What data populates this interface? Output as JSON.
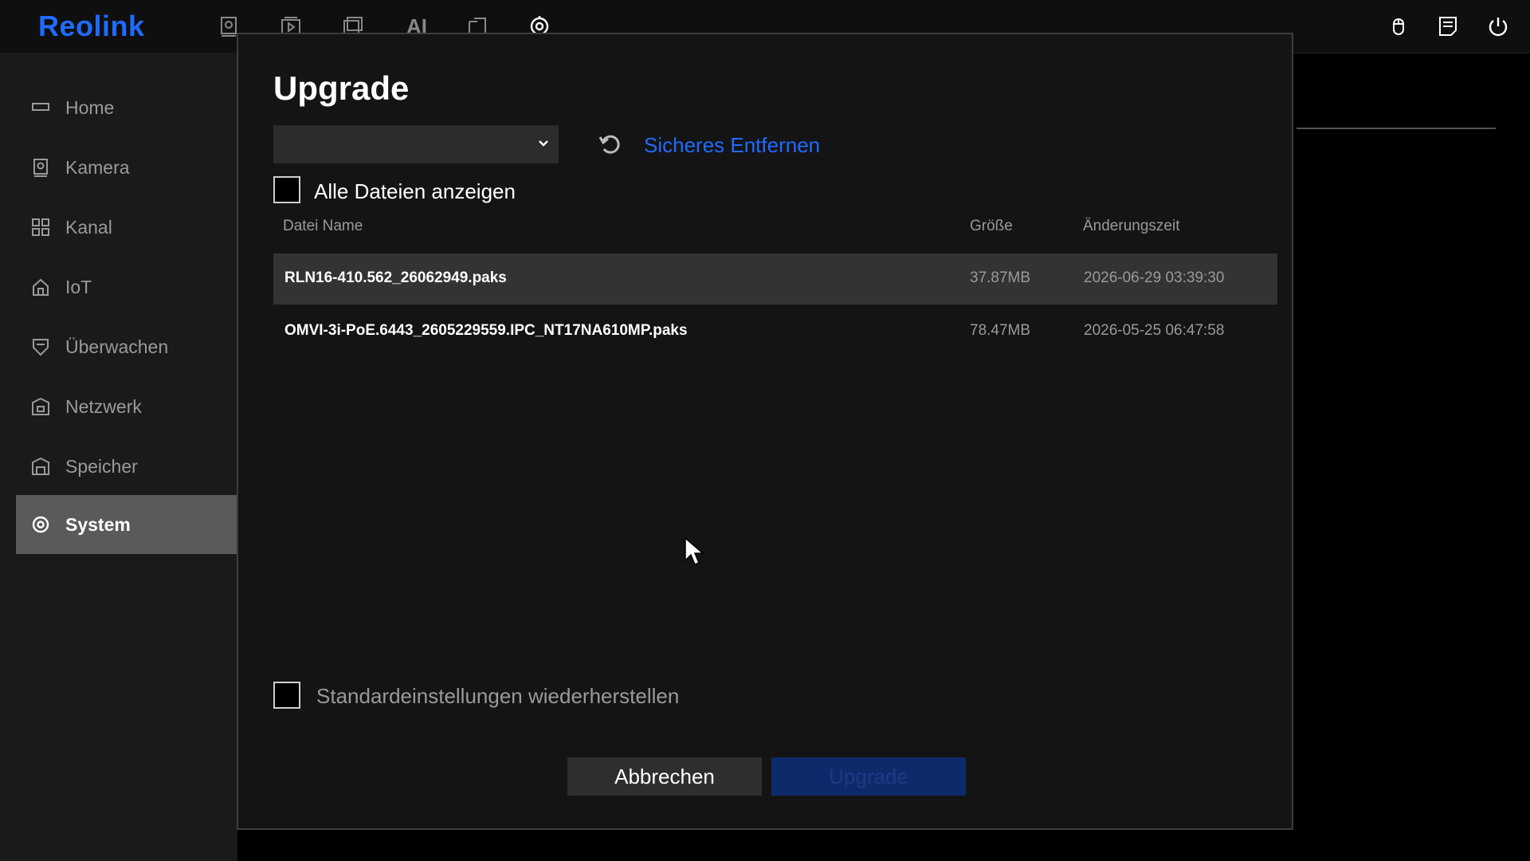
{
  "app": {
    "logo_text": "Reolink",
    "brand_color": "#1f6bff"
  },
  "topbar": {
    "icons": [
      "live-view-icon",
      "playback-icon",
      "backup-icon",
      "ai-icon",
      "file-icon",
      "settings-icon"
    ],
    "ai_label": "AI",
    "right_icons": [
      "mouse-icon",
      "notes-icon",
      "power-icon"
    ]
  },
  "sidebar": {
    "items": [
      {
        "label": "Home",
        "icon": "home-icon"
      },
      {
        "label": "Kamera",
        "icon": "camera-icon"
      },
      {
        "label": "Kanal",
        "icon": "grid-icon"
      },
      {
        "label": "IoT",
        "icon": "iot-icon"
      },
      {
        "label": "Überwachen",
        "icon": "shield-icon"
      },
      {
        "label": "Netzwerk",
        "icon": "network-icon"
      },
      {
        "label": "Speicher",
        "icon": "storage-icon"
      },
      {
        "label": "System",
        "icon": "gear-icon",
        "active": true
      }
    ]
  },
  "modal": {
    "title": "Upgrade",
    "select_value": "",
    "link_label": "Sicheres Entfernen",
    "show_all_label": "Alle Dateien anzeigen",
    "show_all_checked": false,
    "columns": {
      "name": "Datei Name",
      "size": "Größe",
      "time": "Änderungszeit"
    },
    "files": [
      {
        "name": "RLN16-410.562_26062949.paks",
        "size": "37.87MB",
        "time": "2026-06-29 03:39:30",
        "selected": true
      },
      {
        "name": "OMVI-3i-PoE.6443_2605229559.IPC_NT17NA610MP.paks",
        "size": "78.47MB",
        "time": "2026-05-25 06:47:58",
        "selected": false
      }
    ],
    "restore_label": "Standardeinstellungen wiederherstellen",
    "restore_checked": false,
    "cancel_label": "Abbrechen",
    "upgrade_label": "Upgrade"
  }
}
